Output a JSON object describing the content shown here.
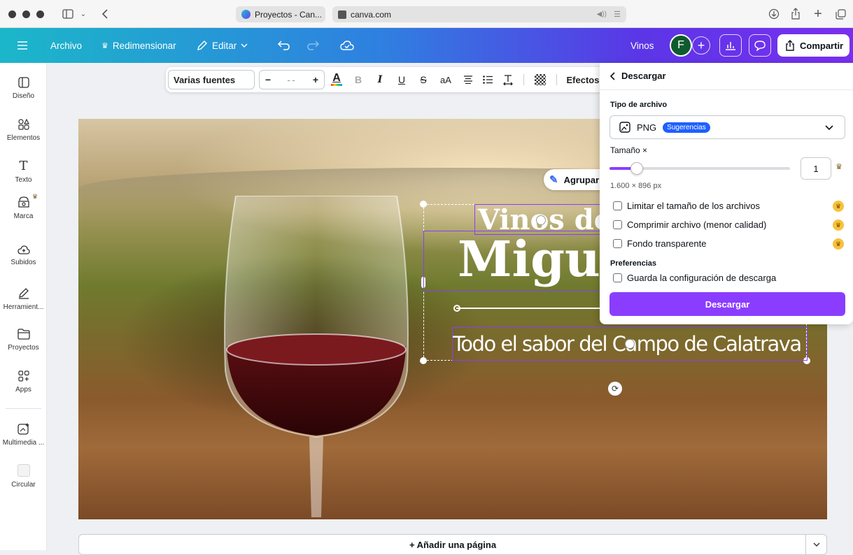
{
  "browser": {
    "tab1_title": "Proyectos - Can...",
    "url": "canva.com"
  },
  "header": {
    "file": "Archivo",
    "resize": "Redimensionar",
    "edit": "Editar",
    "design_name": "Vinos",
    "avatar_letter": "F",
    "share": "Compartir"
  },
  "sidebar": {
    "items": [
      {
        "label": "Diseño",
        "icon": "layout-icon"
      },
      {
        "label": "Elementos",
        "icon": "shapes-icon"
      },
      {
        "label": "Texto",
        "icon": "text-icon"
      },
      {
        "label": "Marca",
        "icon": "brand-icon"
      },
      {
        "label": "Subidos",
        "icon": "cloud-upload-icon"
      },
      {
        "label": "Herramient...",
        "icon": "draw-icon"
      },
      {
        "label": "Proyectos",
        "icon": "folder-icon"
      },
      {
        "label": "Apps",
        "icon": "apps-icon"
      },
      {
        "label": "Multimedia ...",
        "icon": "media-icon"
      },
      {
        "label": "Circular",
        "icon": "circular-thumb-icon"
      }
    ]
  },
  "text_toolbar": {
    "font": "Varias fuentes",
    "size": "--",
    "effects": "Efectos"
  },
  "canvas": {
    "title_line1": "Vinos de",
    "title_line2": "Migue",
    "subtitle": "Todo el sabor del Campo de Calatrava",
    "group_button": "Agrupar"
  },
  "add_page": "+ Añadir una página",
  "download_panel": {
    "title": "Descargar",
    "file_type_label": "Tipo de archivo",
    "file_type": "PNG",
    "suggestions_badge": "Sugerencias",
    "size_label": "Tamaño ×",
    "size_value": "1",
    "size_fraction": 0.15,
    "dimensions": "1.600 × 896 px",
    "options": [
      {
        "label": "Limitar el tamaño de los archivos",
        "pro": true
      },
      {
        "label": "Comprimir archivo (menor calidad)",
        "pro": true
      },
      {
        "label": "Fondo transparente",
        "pro": true
      }
    ],
    "preferences_label": "Preferencias",
    "save_settings": "Guarda la configuración de descarga",
    "download_button": "Descargar"
  },
  "colors": {
    "accent": "#8b3dff",
    "badge": "#1f5fff",
    "crown": "#f7c23b"
  }
}
